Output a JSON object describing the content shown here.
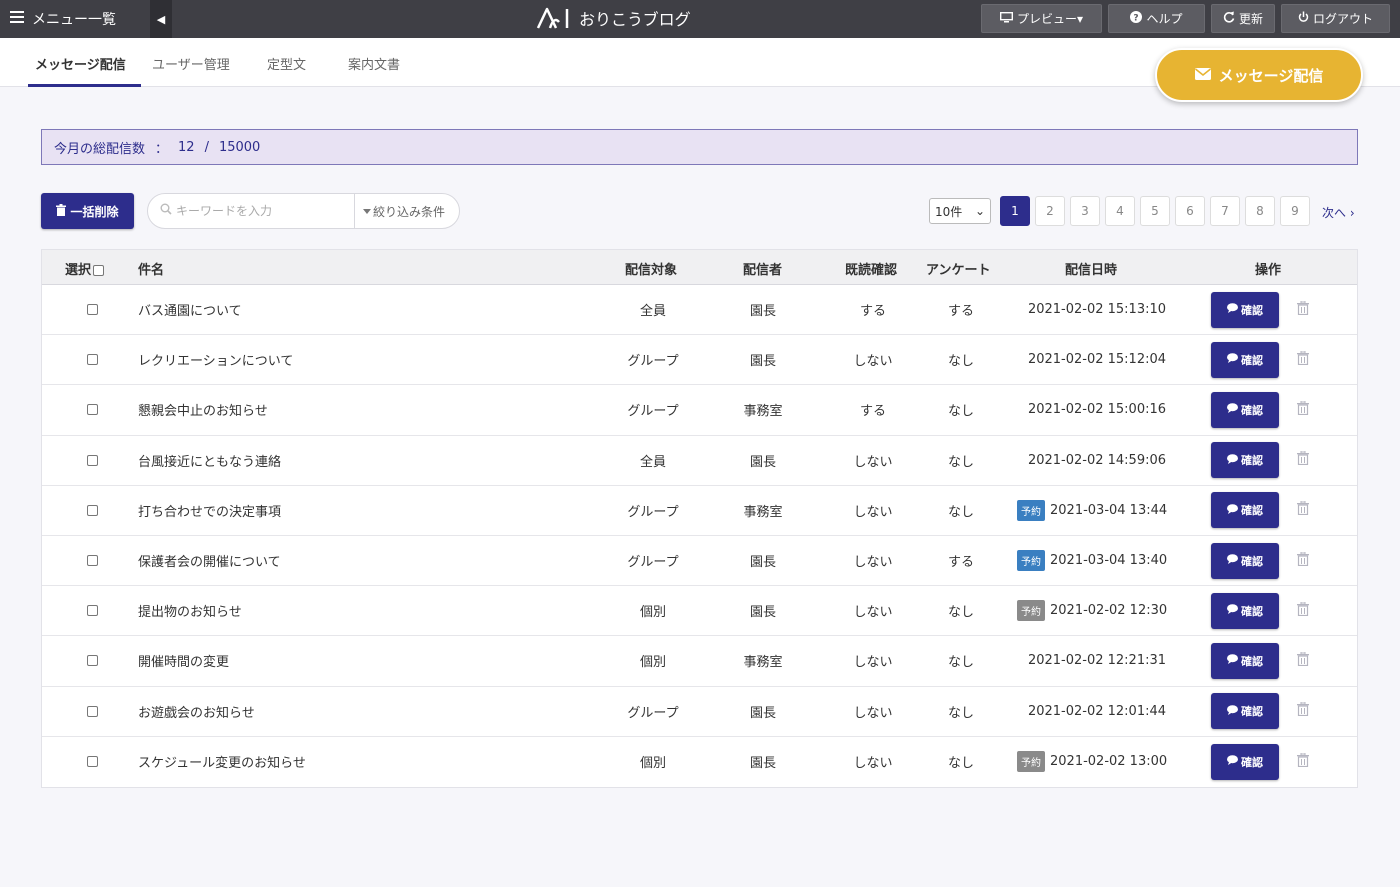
{
  "topbar": {
    "menu_label": "メニュー一覧",
    "collapse_glyph": "◀",
    "app_name": "おりこうブログ",
    "preview_label": "プレビュー▾",
    "help_label": "ヘルプ",
    "refresh_label": "更新",
    "logout_label": "ログアウト"
  },
  "tabs": [
    {
      "label": "メッセージ配信",
      "active": true
    },
    {
      "label": "ユーザー管理",
      "active": false
    },
    {
      "label": "定型文",
      "active": false
    },
    {
      "label": "案内文書",
      "active": false
    }
  ],
  "cta_label": "メッセージ配信",
  "notice": {
    "label": "今月の総配信数",
    "sep": "：",
    "count": "12",
    "slash": "/",
    "limit": "15000"
  },
  "toolbar": {
    "bulk_delete_label": "一括削除",
    "search_placeholder": "キーワードを入力",
    "filter_label": "絞り込み条件",
    "per_page": "10件",
    "per_page_arrow": "⌄",
    "pages": [
      "1",
      "2",
      "3",
      "4",
      "5",
      "6",
      "7",
      "8",
      "9"
    ],
    "next_label": "次へ ›"
  },
  "table": {
    "headers": {
      "select": "選択",
      "subject": "件名",
      "target": "配信対象",
      "sender": "配信者",
      "read": "既読確認",
      "survey": "アンケート",
      "datetime": "配信日時",
      "action": "操作"
    },
    "confirm_label": "確認",
    "rows": [
      {
        "subject": "バス通園について",
        "target": "全員",
        "sender": "園長",
        "read": "する",
        "survey": "する",
        "badge": "",
        "datetime": "2021-02-02 15:13:10"
      },
      {
        "subject": "レクリエーションについて",
        "target": "グループ",
        "sender": "園長",
        "read": "しない",
        "survey": "なし",
        "badge": "",
        "datetime": "2021-02-02 15:12:04"
      },
      {
        "subject": "懇親会中止のお知らせ",
        "target": "グループ",
        "sender": "事務室",
        "read": "する",
        "survey": "なし",
        "badge": "",
        "datetime": "2021-02-02 15:00:16"
      },
      {
        "subject": "台風接近にともなう連絡",
        "target": "全員",
        "sender": "園長",
        "read": "しない",
        "survey": "なし",
        "badge": "",
        "datetime": "2021-02-02 14:59:06"
      },
      {
        "subject": "打ち合わせでの決定事項",
        "target": "グループ",
        "sender": "事務室",
        "read": "しない",
        "survey": "なし",
        "badge": "予約",
        "badge_color": "#3a7fc1",
        "datetime": "2021-03-04 13:44"
      },
      {
        "subject": "保護者会の開催について",
        "target": "グループ",
        "sender": "園長",
        "read": "しない",
        "survey": "する",
        "badge": "予約",
        "badge_color": "#3a7fc1",
        "datetime": "2021-03-04 13:40"
      },
      {
        "subject": "提出物のお知らせ",
        "target": "個別",
        "sender": "園長",
        "read": "しない",
        "survey": "なし",
        "badge": "予約",
        "badge_color": "#8a8a8a",
        "datetime": "2021-02-02 12:30"
      },
      {
        "subject": "開催時間の変更",
        "target": "個別",
        "sender": "事務室",
        "read": "しない",
        "survey": "なし",
        "badge": "",
        "datetime": "2021-02-02 12:21:31"
      },
      {
        "subject": "お遊戯会のお知らせ",
        "target": "グループ",
        "sender": "園長",
        "read": "しない",
        "survey": "なし",
        "badge": "",
        "datetime": "2021-02-02 12:01:44"
      },
      {
        "subject": "スケジュール変更のお知らせ",
        "target": "個別",
        "sender": "園長",
        "read": "しない",
        "survey": "なし",
        "badge": "予約",
        "badge_color": "#8a8a8a",
        "datetime": "2021-02-02 13:00"
      }
    ]
  },
  "colors": {
    "primary": "#2d2d8c",
    "accent": "#e7b432",
    "topbar": "#3f3f45",
    "badge_upcoming": "#3a7fc1",
    "badge_past": "#8a8a8a"
  }
}
